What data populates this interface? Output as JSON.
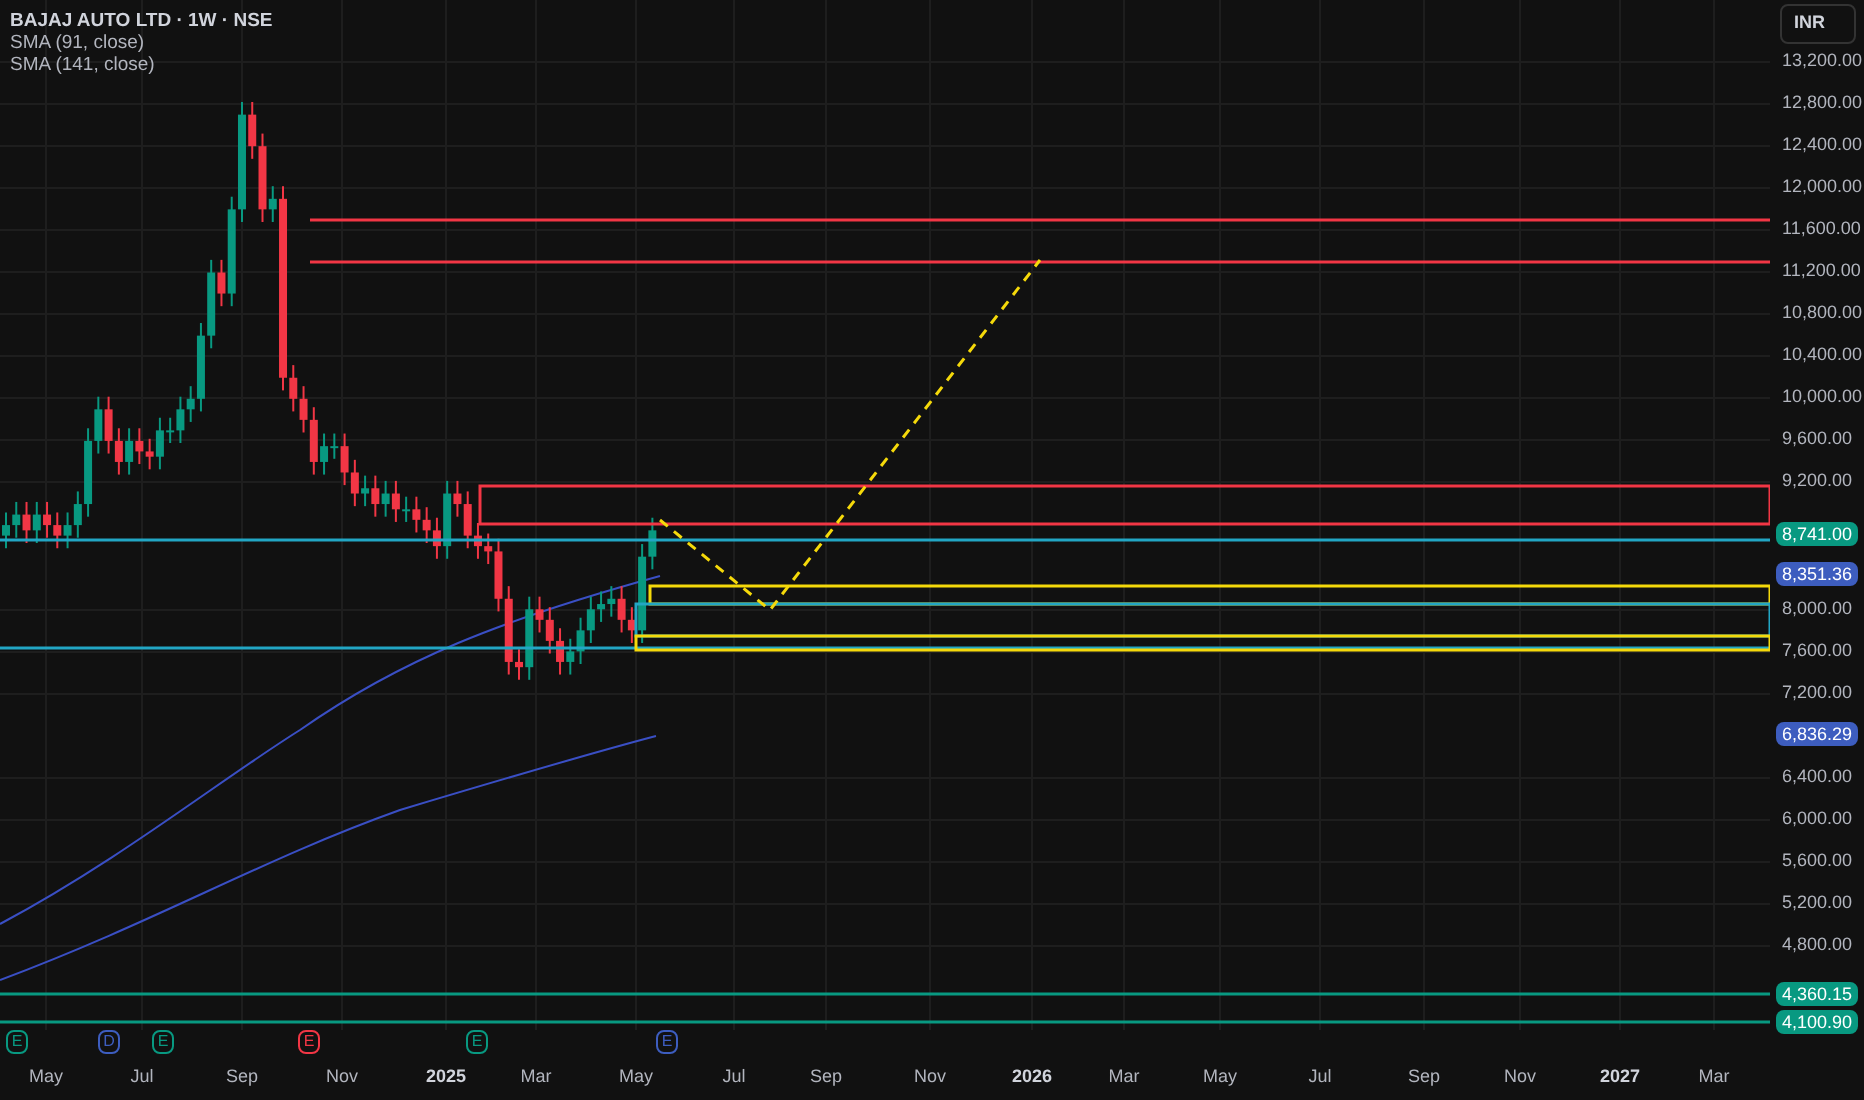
{
  "header": {
    "symbol": "BAJAJ AUTO LTD · 1W · NSE",
    "indicators": [
      "SMA (91, close)",
      "SMA (141, close)"
    ]
  },
  "currency_button": "INR",
  "price_labels": [
    "13,200.00",
    "12,800.00",
    "12,400.00",
    "12,000.00",
    "11,600.00",
    "11,200.00",
    "10,800.00",
    "10,400.00",
    "10,000.00",
    "9,600.00",
    "9,200.00",
    "8,000.00",
    "7,600.00",
    "7,200.00",
    "6,400.00",
    "6,000.00",
    "5,600.00",
    "5,200.00",
    "4,800.00"
  ],
  "price_badges": [
    {
      "text": "8,741.00",
      "color": "#089981"
    },
    {
      "text": "8,351.36",
      "color": "#3d5dbf"
    },
    {
      "text": "6,836.29",
      "color": "#3d5dbf"
    },
    {
      "text": "4,360.15",
      "color": "#089981"
    },
    {
      "text": "4,100.90",
      "color": "#089981"
    }
  ],
  "time_labels": [
    "May",
    "Jul",
    "Sep",
    "Nov",
    "2025",
    "Mar",
    "May",
    "Jul",
    "Sep",
    "Nov",
    "2026",
    "Mar",
    "May",
    "Jul",
    "Sep",
    "Nov",
    "2027",
    "Mar"
  ],
  "events": [
    {
      "letter": "E",
      "color": "#089981"
    },
    {
      "letter": "D",
      "color": "#3d5dbf"
    },
    {
      "letter": "E",
      "color": "#089981"
    },
    {
      "letter": "E",
      "color": "#f23645"
    },
    {
      "letter": "E",
      "color": "#089981"
    },
    {
      "letter": "E",
      "color": "#3d5dbf"
    }
  ]
}
